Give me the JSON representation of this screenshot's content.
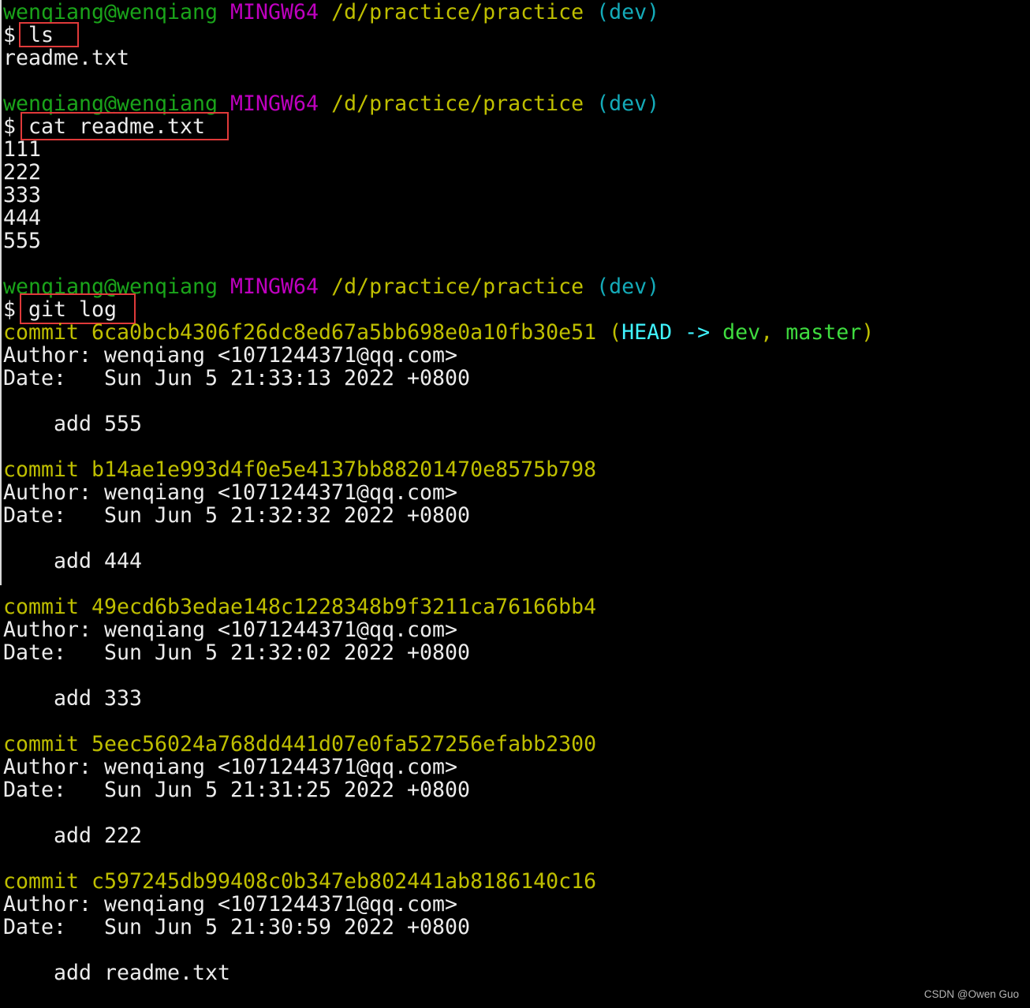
{
  "terminal": {
    "colors": {
      "background": "#000000",
      "foreground": "#ececec",
      "user_host": "#1aa41a",
      "shell": "#bf00bf",
      "path": "#bfbf00",
      "branch": "#14abb9",
      "commit": "#bfbf00",
      "head_ref": "#40f4ff",
      "branch_ref": "#3fdc3f",
      "highlight": "#e03a3a",
      "watermark": "#b4b4b4",
      "window_edge": "#d8d8d8"
    },
    "sessions": [
      {
        "prompt": {
          "user_host": "wenqiang@wenqiang",
          "shell": "MINGW64",
          "path": "/d/practice/practice",
          "branch": "(dev)"
        },
        "symbol": "$",
        "command": "ls",
        "output": [
          "readme.txt"
        ]
      },
      {
        "prompt": {
          "user_host": "wenqiang@wenqiang",
          "shell": "MINGW64",
          "path": "/d/practice/practice",
          "branch": "(dev)"
        },
        "symbol": "$",
        "command": "cat readme.txt",
        "output": [
          "111",
          "222",
          "333",
          "444",
          "555"
        ]
      },
      {
        "prompt": {
          "user_host": "wenqiang@wenqiang",
          "shell": "MINGW64",
          "path": "/d/practice/practice",
          "branch": "(dev)"
        },
        "symbol": "$",
        "command": "git log",
        "commits": [
          {
            "label": "commit",
            "hash": "6ca0bcb4306f26dc8ed67a5bb698e0a10fb30e51",
            "refs": {
              "open": "(",
              "head": "HEAD ->",
              "branches": [
                "dev",
                "master"
              ],
              "separator": ",",
              "close": ")"
            },
            "author_label": "Author:",
            "author": "wenqiang <1071244371@qq.com>",
            "date_label": "Date:",
            "date": "Sun Jun 5 21:33:13 2022 +0800",
            "message": "add 555"
          },
          {
            "label": "commit",
            "hash": "b14ae1e993d4f0e5e4137bb88201470e8575b798",
            "author_label": "Author:",
            "author": "wenqiang <1071244371@qq.com>",
            "date_label": "Date:",
            "date": "Sun Jun 5 21:32:32 2022 +0800",
            "message": "add 444"
          },
          {
            "label": "commit",
            "hash": "49ecd6b3edae148c1228348b9f3211ca76166bb4",
            "author_label": "Author:",
            "author": "wenqiang <1071244371@qq.com>",
            "date_label": "Date:",
            "date": "Sun Jun 5 21:32:02 2022 +0800",
            "message": "add 333"
          },
          {
            "label": "commit",
            "hash": "5eec56024a768dd441d07e0fa527256efabb2300",
            "author_label": "Author:",
            "author": "wenqiang <1071244371@qq.com>",
            "date_label": "Date:",
            "date": "Sun Jun 5 21:31:25 2022 +0800",
            "message": "add 222"
          },
          {
            "label": "commit",
            "hash": "c597245db99408c0b347eb802441ab8186140c16",
            "author_label": "Author:",
            "author": "wenqiang <1071244371@qq.com>",
            "date_label": "Date:",
            "date": "Sun Jun 5 21:30:59 2022 +0800",
            "message": "add readme.txt"
          }
        ]
      }
    ]
  },
  "watermark": "CSDN @Owen Guo"
}
